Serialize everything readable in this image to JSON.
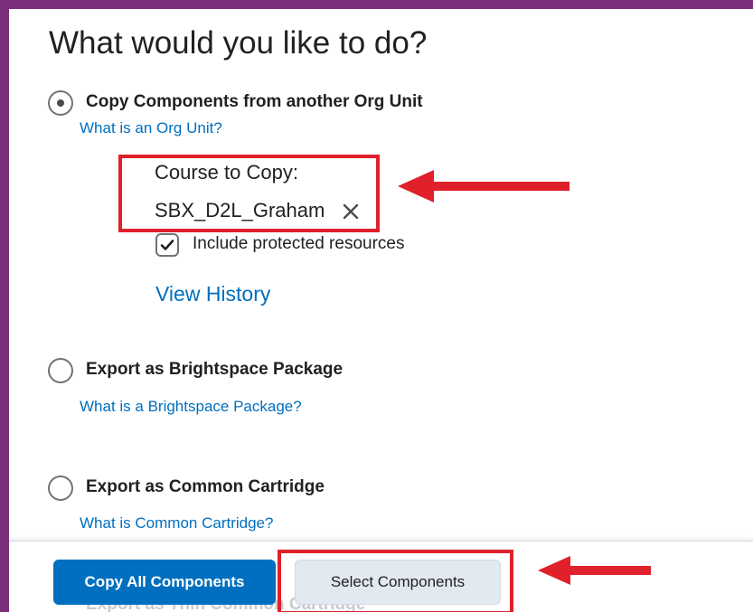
{
  "page": {
    "title": "What would you like to do?"
  },
  "options": [
    {
      "label": "Copy Components from another Org Unit",
      "help": "What is an Org Unit?",
      "selected": true
    },
    {
      "label": "Export as Brightspace Package",
      "help": "What is a Brightspace Package?",
      "selected": false
    },
    {
      "label": "Export as Common Cartridge",
      "help": "What is Common Cartridge?",
      "selected": false
    }
  ],
  "copy_settings": {
    "course_label": "Course to Copy:",
    "course_value": "SBX_D2L_Graham",
    "include_protected_label": "Include protected resources",
    "include_protected_checked": true,
    "view_history": "View History"
  },
  "footer": {
    "copy_all_label": "Copy All Components",
    "select_components_label": "Select Components",
    "obscured_text": "Export as Thin Common Cartridge"
  },
  "icons": {
    "remove": "close-icon",
    "check": "checkmark-icon",
    "annotation_arrow": "red-arrow-icon"
  },
  "colors": {
    "link": "#006fbf",
    "primary_button": "#006fbf",
    "annotation": "#e0202a",
    "frame": "#7b2f7b"
  }
}
